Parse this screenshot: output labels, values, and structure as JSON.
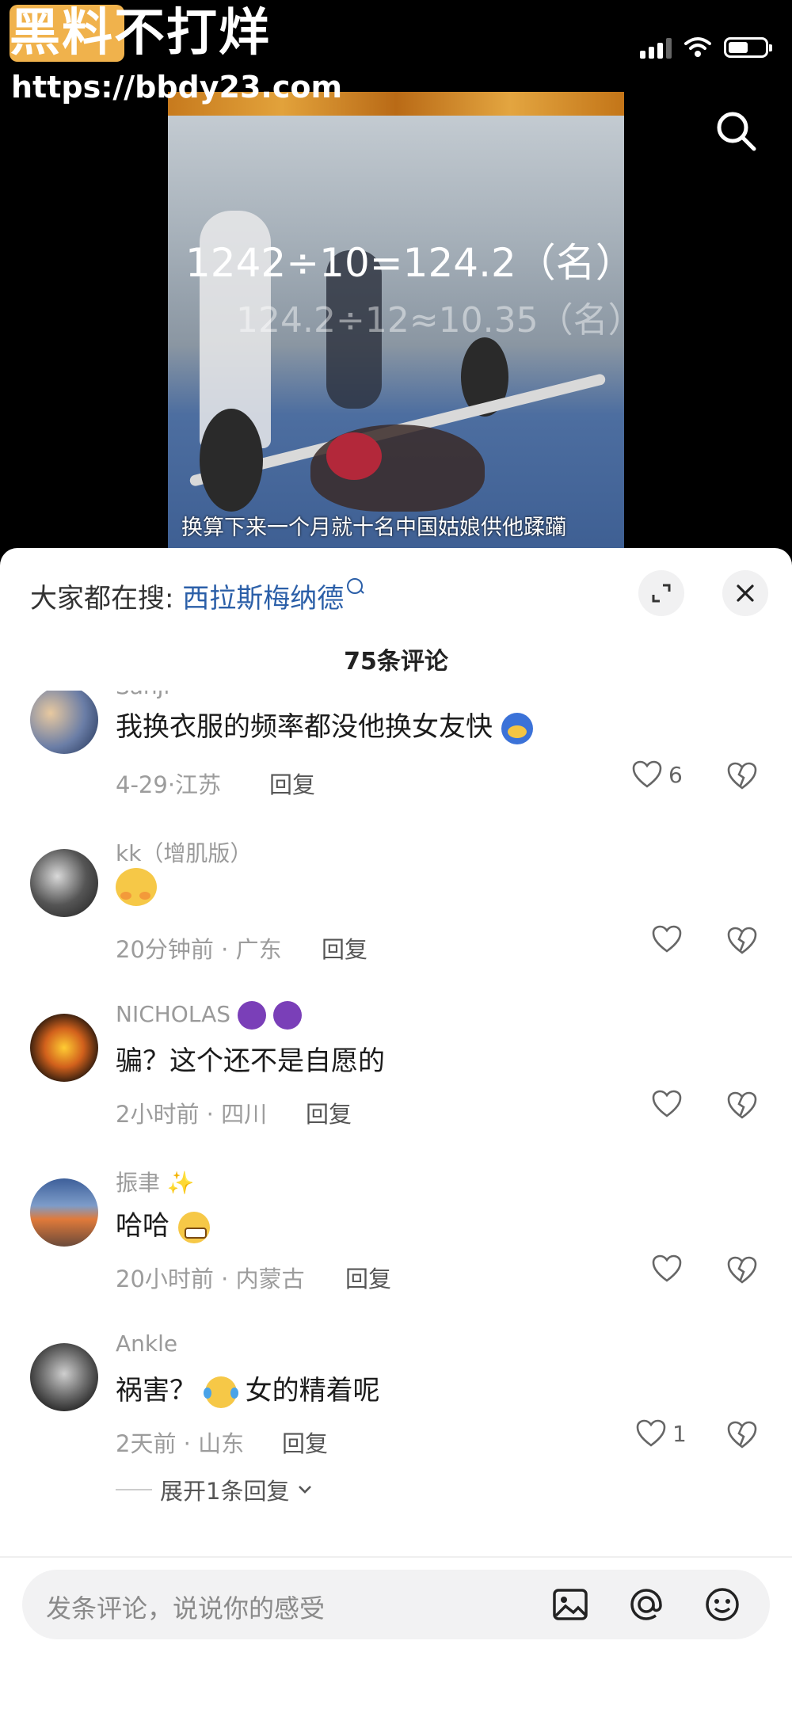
{
  "watermark": {
    "title": "黑料不打烊",
    "url": "https://bbdy23.com"
  },
  "video": {
    "overlay_line1": "1242÷10=124.2（名）",
    "overlay_line2": "124.2÷12≈10.35（名）",
    "caption": "换算下来一个月就十名中国姑娘供他蹂躏"
  },
  "search_bar": {
    "label": "大家都在搜:",
    "keyword": "西拉斯梅纳德"
  },
  "comment_count": "75条评论",
  "comments": [
    {
      "user": "Sanji",
      "text": "我换衣服的频率都没他换女友快",
      "time": "4-29",
      "location": "江苏",
      "reply": "回复",
      "likes": "6",
      "emoji": "sweat-blue"
    },
    {
      "user": "kk（增肌版）",
      "text": "",
      "time": "20分钟前",
      "location": "广东",
      "reply": "回复",
      "likes": "",
      "emoji": "hug-face"
    },
    {
      "user": "NICHOLAS",
      "text": "骗？这个还不是自愿的",
      "time": "2小时前",
      "location": "四川",
      "reply": "回复",
      "likes": "",
      "emoji": "devil-purple"
    },
    {
      "user": "振聿",
      "text": "哈哈",
      "time": "20小时前",
      "location": "内蒙古",
      "reply": "回复",
      "likes": "",
      "emoji": "grin"
    },
    {
      "user": "Ankle",
      "text_a": "祸害？",
      "text_b": "女的精着呢",
      "time": "2天前",
      "location": "山东",
      "reply": "回复",
      "likes": "1",
      "emoji": "tears-joy",
      "expand": "展开1条回复"
    }
  ],
  "input": {
    "placeholder": "发条评论，说说你的感受"
  },
  "colors": {
    "link": "#2b5fa8",
    "watermark_bg": "#f0b24c"
  }
}
